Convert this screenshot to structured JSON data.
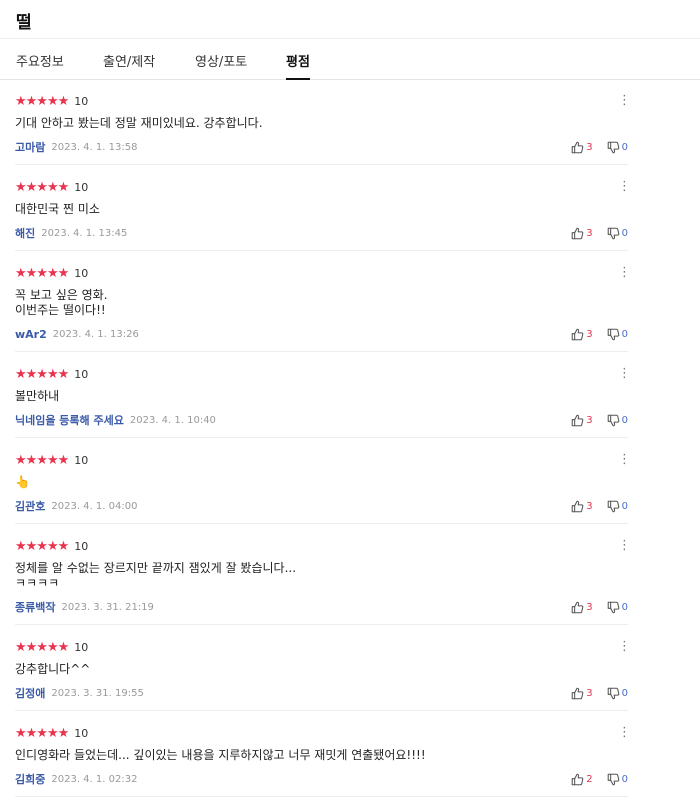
{
  "header": {
    "title": "떨"
  },
  "tabs": [
    {
      "label": "주요정보"
    },
    {
      "label": "출연/제작"
    },
    {
      "label": "영상/포토"
    },
    {
      "label": "평점",
      "active": true
    }
  ],
  "colors": {
    "star": "#e8344e",
    "author": "#3b5ba8",
    "like": "#e8344e",
    "dislike": "#4b6fd0"
  },
  "icons": {
    "star": "star-icon",
    "more": "more-vertical-icon",
    "like": "thumbs-up-icon",
    "dislike": "thumbs-down-icon"
  },
  "reviews": [
    {
      "stars": "★★★★★",
      "score": "10",
      "text": "기대 안하고 봤는데 정말 재미있네요. 강추합니다.",
      "author": "고마람",
      "date": "2023. 4. 1. 13:58",
      "likes": "3",
      "dislikes": "0"
    },
    {
      "stars": "★★★★★",
      "score": "10",
      "text": "대한민국  찐 미소",
      "author": "해진",
      "date": "2023. 4. 1. 13:45",
      "likes": "3",
      "dislikes": "0"
    },
    {
      "stars": "★★★★★",
      "score": "10",
      "text": "꼭 보고 싶은 영화.\n이번주는 떨이다!!",
      "author": "wAr2",
      "date": "2023. 4. 1. 13:26",
      "likes": "3",
      "dislikes": "0"
    },
    {
      "stars": "★★★★★",
      "score": "10",
      "text": "볼만하내",
      "author": "닉네임을 등록해 주세요",
      "date": "2023. 4. 1. 10:40",
      "likes": "3",
      "dislikes": "0"
    },
    {
      "stars": "★★★★★",
      "score": "10",
      "text": "👆",
      "author": "김관호",
      "date": "2023. 4. 1. 04:00",
      "likes": "3",
      "dislikes": "0"
    },
    {
      "stars": "★★★★★",
      "score": "10",
      "text": "정체를 알 수없는 장르지만 끝까지 잼있게 잘 봤습니다...\nㅋㅋㅋㅋ",
      "author": "종류백작",
      "date": "2023. 3. 31. 21:19",
      "likes": "3",
      "dislikes": "0"
    },
    {
      "stars": "★★★★★",
      "score": "10",
      "text": "강추합니다^^",
      "author": "김정애",
      "date": "2023. 3. 31. 19:55",
      "likes": "3",
      "dislikes": "0"
    },
    {
      "stars": "★★★★★",
      "score": "10",
      "text": "인디영화라 들었는데... 깊이있는 내용을  지루하지않고 너무 재밋게 연출됐어요!!!!",
      "author": "김희중",
      "date": "2023. 4. 1. 02:32",
      "likes": "2",
      "dislikes": "0"
    }
  ]
}
